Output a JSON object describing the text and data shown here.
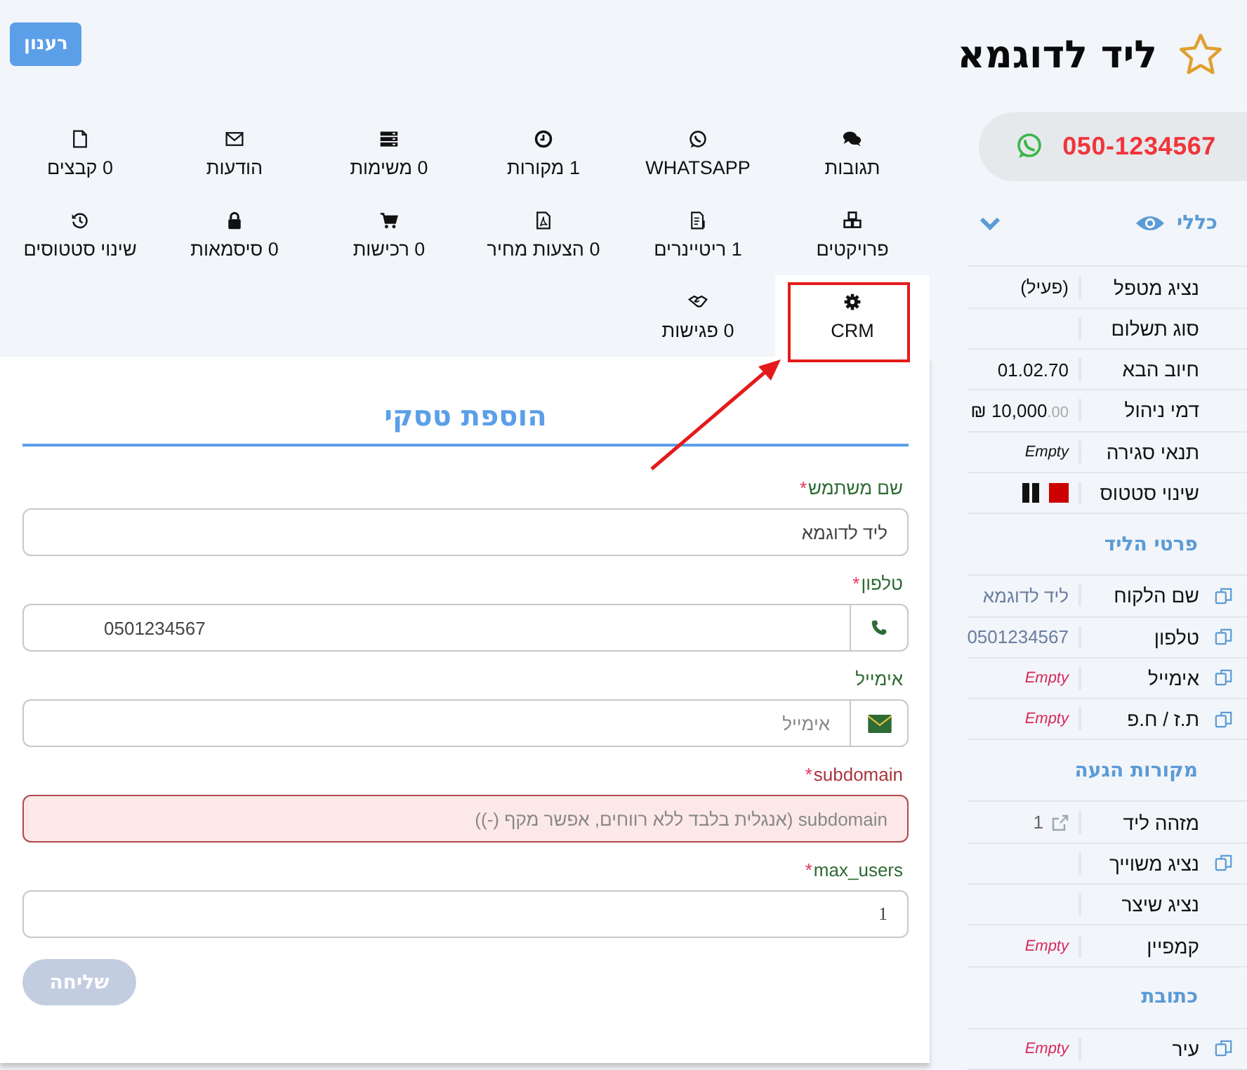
{
  "header": {
    "title": "ליד לדוגמא",
    "refresh_button": "רענון"
  },
  "tabs": [
    {
      "label": "תגובות",
      "selected": false,
      "highlighted": false
    },
    {
      "label": "WHATSAPP",
      "selected": false,
      "highlighted": false
    },
    {
      "label": "1 מקורות",
      "selected": false,
      "highlighted": false
    },
    {
      "label": "0 משימות",
      "selected": false,
      "highlighted": false
    },
    {
      "label": "הודעות",
      "selected": false,
      "highlighted": false
    },
    {
      "label": "0 קבצים",
      "selected": false,
      "highlighted": false
    },
    {
      "label": "פרויקטים",
      "selected": false,
      "highlighted": false
    },
    {
      "label": "1 ריטיינרים",
      "selected": false,
      "highlighted": false
    },
    {
      "label": "0 הצעות מחיר",
      "selected": false,
      "highlighted": false
    },
    {
      "label": "0 רכישות",
      "selected": false,
      "highlighted": false
    },
    {
      "label": "0 סיסמאות",
      "selected": false,
      "highlighted": false
    },
    {
      "label": "שינוי סטטוסים",
      "selected": false,
      "highlighted": false
    },
    {
      "label": "CRM",
      "selected": true,
      "highlighted": true
    },
    {
      "label": "0 פגישות",
      "selected": false,
      "highlighted": false
    }
  ],
  "form": {
    "title": "הוספת טסקי",
    "fields": [
      {
        "label": "שם משתמש",
        "required_mark": "*",
        "kind": "text",
        "value": "ליד לדוגמא",
        "error": false
      },
      {
        "label": "טלפון",
        "required_mark": "*",
        "kind": "phone",
        "value": "0501234567",
        "error": false
      },
      {
        "label": "אימייל",
        "kind": "email",
        "placeholder": "אימייל",
        "error": false
      },
      {
        "label": "subdomain",
        "required_mark": "*",
        "kind": "text",
        "placeholder": "subdomain (אנגלית בלבד ללא רווחים, אפשר מקף (-))",
        "error": true
      },
      {
        "label": "max_users",
        "required_mark": "*",
        "kind": "number",
        "value": "1",
        "error": false
      }
    ],
    "submit": {
      "label": "שליחה",
      "disabled": true
    }
  },
  "sidebar": {
    "phone": "050-1234567",
    "sections": [
      {
        "title": "כללי",
        "kind": "toggle",
        "rows": [
          {
            "label": "נציג מטפל",
            "value": "(פעיל)",
            "kind": "text",
            "copy": false
          },
          {
            "label": "סוג תשלום",
            "kind": "text",
            "copy": false
          },
          {
            "label": "חיוב הבא",
            "value": "01.02.70",
            "kind": "text",
            "copy": false
          },
          {
            "label": "דמי ניהול",
            "value": "10,000",
            "decimals": ".00",
            "currency": "₪",
            "kind": "money",
            "copy": false
          },
          {
            "label": "תנאי סגירה",
            "value": "Empty",
            "kind": "empty-dark",
            "copy": false
          },
          {
            "label": "שינוי סטטוס",
            "kind": "status",
            "copy": false
          }
        ]
      },
      {
        "title": "פרטי הליד",
        "kind": "plain",
        "rows": [
          {
            "label": "שם הלקוח",
            "value": "ליד לדוגמא",
            "kind": "muted",
            "copy": true
          },
          {
            "label": "טלפון",
            "value": "0501234567",
            "kind": "muted",
            "copy": true
          },
          {
            "label": "אימייל",
            "value": "Empty",
            "kind": "empty",
            "copy": true
          },
          {
            "label": "ת.ז / ח.פ",
            "value": "Empty",
            "kind": "empty",
            "copy": true
          }
        ]
      },
      {
        "title": "מקורות הגעה",
        "kind": "plain",
        "rows": [
          {
            "label": "מזהה ליד",
            "value": "1",
            "kind": "link",
            "copy": false
          },
          {
            "label": "נציג משוייך",
            "kind": "text",
            "copy": true
          },
          {
            "label": "נציג שיצר",
            "kind": "text",
            "copy": false
          },
          {
            "label": "קמפיין",
            "value": "Empty",
            "kind": "empty",
            "copy": false
          }
        ]
      },
      {
        "title": "כתובת",
        "kind": "plain",
        "rows": [
          {
            "label": "עיר",
            "value": "Empty",
            "kind": "empty",
            "copy": true
          }
        ]
      }
    ]
  }
}
